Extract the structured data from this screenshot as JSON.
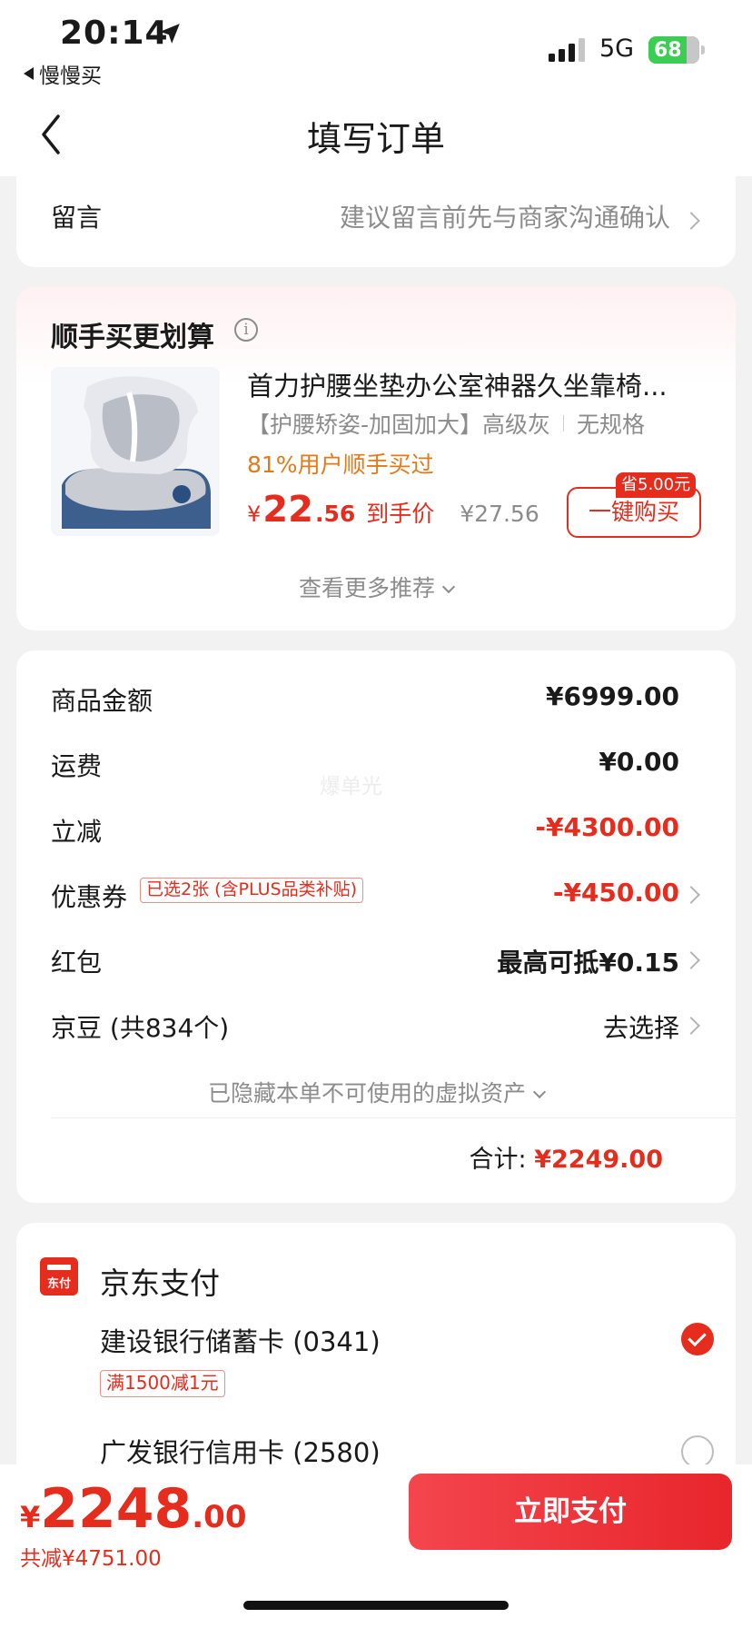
{
  "status": {
    "time": "20:14",
    "back_app": "慢慢买",
    "network": "5G",
    "battery": "68"
  },
  "nav": {
    "title": "填写订单"
  },
  "message": {
    "label": "留言",
    "hint": "建议留言前先与商家沟通确认"
  },
  "recommend": {
    "title": "顺手买更划算",
    "product": {
      "name": "首力护腰坐垫办公室神器久坐靠椅...",
      "spec1": "【护腰矫姿-加固加大】高级灰",
      "spec2": "无规格",
      "note": "81%用户顺手买过",
      "price_symbol": "¥",
      "price_int": "22",
      "price_dec": ".56",
      "price_tag": "到手价",
      "orig_price": "¥27.56",
      "save_badge": "省5.00元",
      "buy_label": "一键购买"
    },
    "more_label": "查看更多推荐"
  },
  "fees": {
    "rows": [
      {
        "label": "商品金额",
        "value": "¥6999.00"
      },
      {
        "label": "运费",
        "value": "¥0.00"
      },
      {
        "label": "立减",
        "value": "-¥4300.00"
      },
      {
        "label": "优惠券",
        "value": "-¥450.00",
        "tag": "已选2张 (含PLUS品类补贴)"
      },
      {
        "label": "红包",
        "value": "最高可抵¥0.15"
      },
      {
        "label": "京豆 (共834个)",
        "value": "去选择"
      }
    ],
    "hidden_assets": "已隐藏本单不可使用的虚拟资产",
    "total_label": "合计:",
    "total_value": "¥2249.00"
  },
  "watermark": "爆单光",
  "payment": {
    "icon_text": "东付",
    "title": "京东支付",
    "option1": "建设银行储蓄卡 (0341)",
    "option1_promo": "满1500减1元",
    "option2": "广发银行信用卡 (2580)"
  },
  "bottom": {
    "symbol": "¥",
    "amount_int": "2248",
    "amount_dec": ".00",
    "saved": "共减¥4751.00",
    "pay_label": "立即支付"
  },
  "colors": {
    "accent": "#e52c1d",
    "note": "#e07a1a",
    "battery": "#3ccd55"
  }
}
